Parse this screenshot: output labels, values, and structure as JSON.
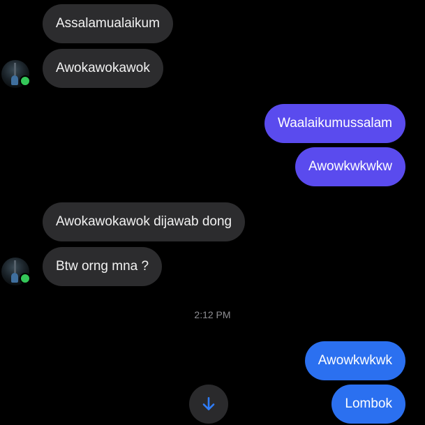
{
  "messages": [
    {
      "text": "Assalamualaikum",
      "direction": "incoming"
    },
    {
      "text": "Awokawokawok",
      "direction": "incoming"
    },
    {
      "text": "Waalaikumussalam",
      "direction": "outgoing"
    },
    {
      "text": "Awowkwkwkw",
      "direction": "outgoing"
    },
    {
      "text": "Awokawokawok dijawab dong",
      "direction": "incoming"
    },
    {
      "text": "Btw orng mna ?",
      "direction": "incoming"
    },
    {
      "text": "Awowkwkwk",
      "direction": "outgoing"
    },
    {
      "text": "Lombok",
      "direction": "outgoing"
    }
  ],
  "timestamp": "2:12 PM",
  "colors": {
    "background": "#000000",
    "incoming_bubble": "#2c2c2e",
    "outgoing_purple": "#5a4bee",
    "outgoing_blue": "#2b70f0",
    "online_indicator": "#34c759",
    "scroll_arrow": "#2f7cf6"
  },
  "icons": {
    "scroll_down": "arrow-down-icon",
    "avatar": "contact-avatar",
    "presence": "online-status-dot"
  }
}
